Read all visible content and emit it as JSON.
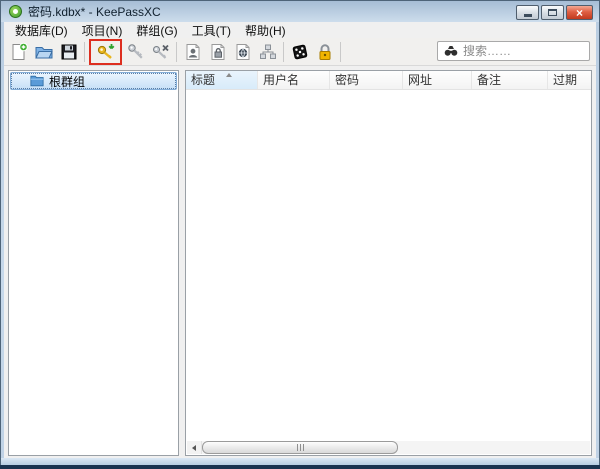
{
  "window": {
    "title": "密码.kdbx* - KeePassXC",
    "close_glyph": "×",
    "controls": [
      "minimize",
      "maximize",
      "close"
    ]
  },
  "menu": {
    "items": [
      "数据库(D)",
      "项目(N)",
      "群组(G)",
      "工具(T)",
      "帮助(H)"
    ]
  },
  "toolbar": {
    "search_placeholder": "搜索……",
    "highlighted_button": "add-entry",
    "highlight_color": "#dd2e1f",
    "buttons": [
      {
        "name": "new-database",
        "icon": "file-plus-icon"
      },
      {
        "name": "open-database",
        "icon": "folder-open-icon"
      },
      {
        "name": "save-database",
        "icon": "floppy-disk-icon"
      },
      {
        "name": "add-entry",
        "icon": "key-plus-icon"
      },
      {
        "name": "edit-entry",
        "icon": "key-icon"
      },
      {
        "name": "delete-entry",
        "icon": "key-x-icon"
      },
      {
        "name": "copy-username",
        "icon": "user-page-icon"
      },
      {
        "name": "copy-password",
        "icon": "lock-page-icon"
      },
      {
        "name": "copy-url",
        "icon": "globe-page-icon"
      },
      {
        "name": "auto-type",
        "icon": "hierarchy-icon"
      },
      {
        "name": "password-generator",
        "icon": "dice-icon"
      },
      {
        "name": "lock-database",
        "icon": "padlock-icon"
      }
    ]
  },
  "sidebar": {
    "groups": [
      {
        "label": "根群组",
        "selected": true,
        "icon": "folder-icon"
      }
    ]
  },
  "table": {
    "headers": [
      "标题",
      "用户名",
      "密码",
      "网址",
      "备注",
      "过期"
    ],
    "sorted_column": "标题",
    "sort_direction": "asc",
    "rows": []
  },
  "colors": {
    "titlebar_top": "#a6bdd5",
    "titlebar_bottom": "#cdddec",
    "close_button_red": "#c23a1f",
    "highlight_red": "#dd2e1f",
    "selection_blue": "#c7e0f7",
    "sorted_header_blue": "#d8ebfa",
    "folder_blue": "#5a9bd8",
    "padlock_gold": "#f0b400",
    "frame_dark_edge": "#1a3350"
  }
}
